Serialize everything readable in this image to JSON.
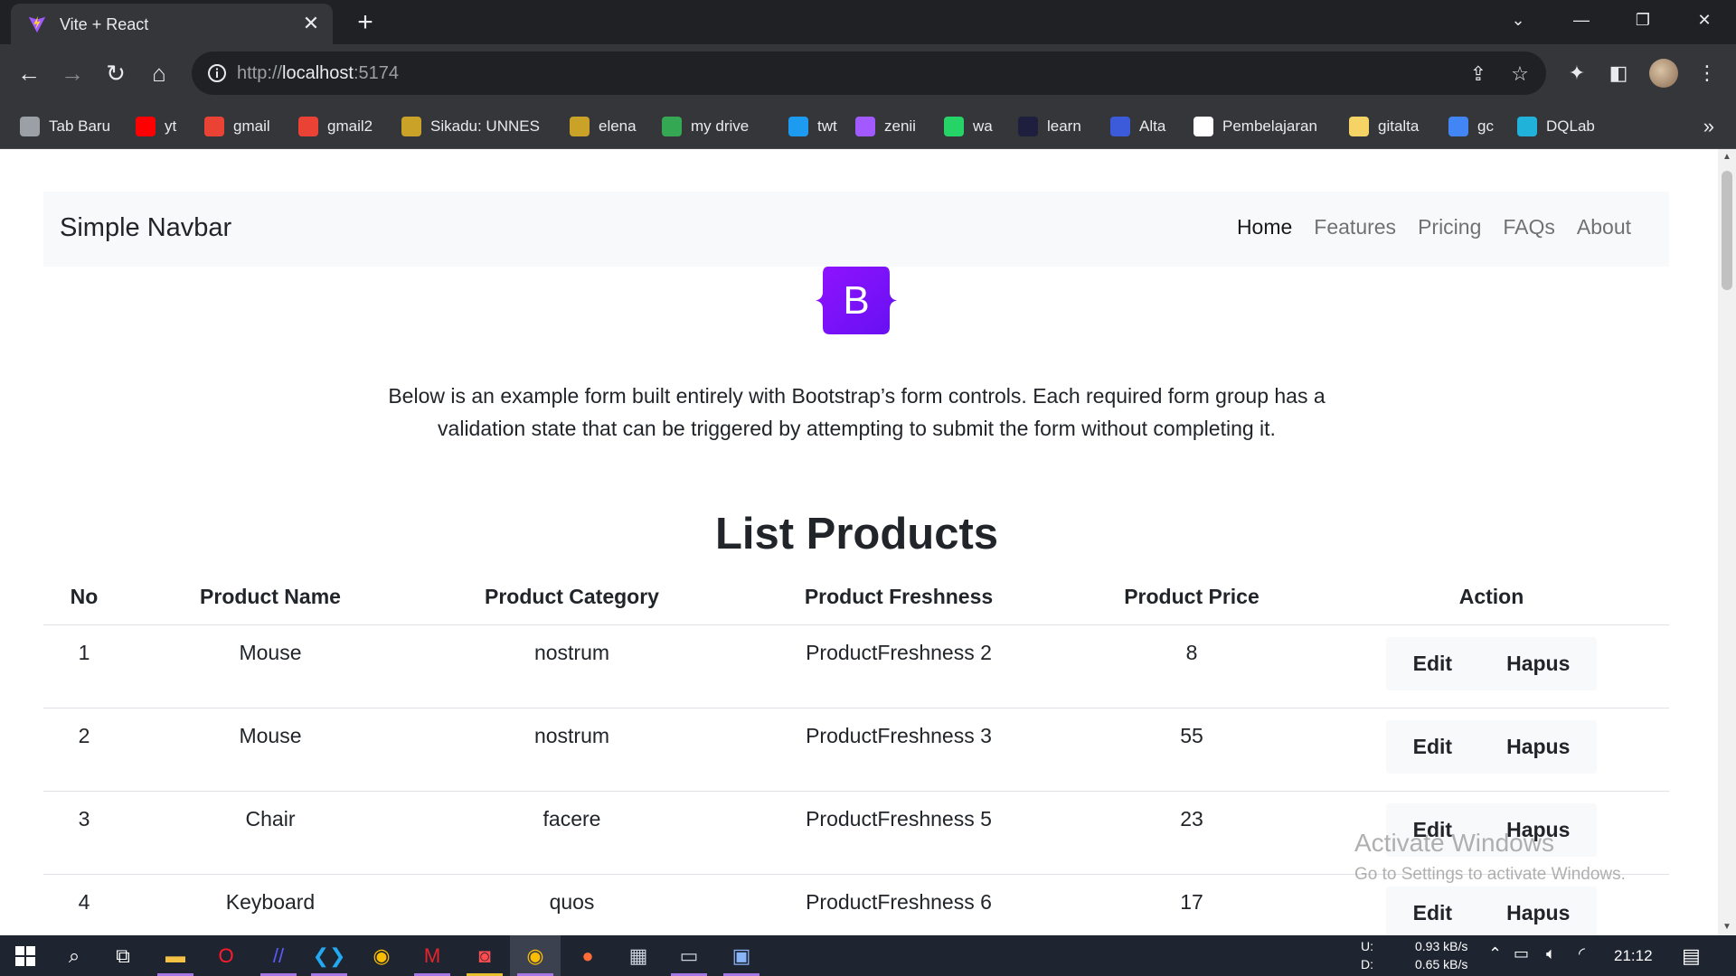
{
  "browser": {
    "tab_title": "Vite + React",
    "tab_close": "✕",
    "new_tab": "+",
    "url_host": "localhost",
    "url_prefix": "http://",
    "url_port": ":5174",
    "window_controls": {
      "chevron": "⌄",
      "minimize": "—",
      "restore": "❐",
      "close": "✕"
    }
  },
  "bookmarks": [
    {
      "label": "Tab Baru",
      "icon": "globe-icon",
      "color": "#9aa0a6"
    },
    {
      "label": "yt",
      "icon": "youtube-icon",
      "color": "#ff0000"
    },
    {
      "label": "gmail",
      "icon": "gmail-icon",
      "color": "#ea4335"
    },
    {
      "label": "gmail2",
      "icon": "gmail-icon",
      "color": "#ea4335"
    },
    {
      "label": "Sikadu: UNNES",
      "icon": "unnes-icon",
      "color": "#c9a227"
    },
    {
      "label": "elena",
      "icon": "unnes-icon",
      "color": "#c9a227"
    },
    {
      "label": "my drive",
      "icon": "drive-icon",
      "color": "#34a853"
    },
    {
      "label": "twt",
      "icon": "twitter-icon",
      "color": "#1d9bf0"
    },
    {
      "label": "zenii",
      "icon": "z-icon",
      "color": "#a259ff"
    },
    {
      "label": "wa",
      "icon": "whatsapp-icon",
      "color": "#25d366"
    },
    {
      "label": "learn",
      "icon": "code-icon",
      "color": "#1e1e3f"
    },
    {
      "label": "Alta",
      "icon": "alta-icon",
      "color": "#3b5bdb"
    },
    {
      "label": "Pembelajaran",
      "icon": "notion-icon",
      "color": "#ffffff"
    },
    {
      "label": "gitalta",
      "icon": "folder-icon",
      "color": "#f6d365"
    },
    {
      "label": "gc",
      "icon": "calendar-icon",
      "color": "#4285f4"
    },
    {
      "label": "DQLab",
      "icon": "dqlab-icon",
      "color": "#20b2d8"
    }
  ],
  "page": {
    "brand": "Simple Navbar",
    "nav": [
      "Home",
      "Features",
      "Pricing",
      "FAQs",
      "About"
    ],
    "logo_letter": "B",
    "logo_color": "#7952b3",
    "lead": "Below is an example form built entirely with Bootstrap’s form controls. Each required form group has a validation state that can be triggered by attempting to submit the form without completing it.",
    "heading": "List Products",
    "table": {
      "headers": [
        "No",
        "Product Name",
        "Product Category",
        "Product Freshness",
        "Product Price",
        "Action"
      ],
      "rows": [
        {
          "no": "1",
          "name": "Mouse",
          "category": "nostrum",
          "freshness": "ProductFreshness 2",
          "price": "8"
        },
        {
          "no": "2",
          "name": "Mouse",
          "category": "nostrum",
          "freshness": "ProductFreshness 3",
          "price": "55"
        },
        {
          "no": "3",
          "name": "Chair",
          "category": "facere",
          "freshness": "ProductFreshness 5",
          "price": "23"
        },
        {
          "no": "4",
          "name": "Keyboard",
          "category": "quos",
          "freshness": "ProductFreshness 6",
          "price": "17"
        }
      ],
      "edit_label": "Edit",
      "delete_label": "Hapus"
    }
  },
  "watermark": {
    "line1": "Activate Windows",
    "line2": "Go to Settings to activate Windows."
  },
  "taskbar": {
    "net_up_label": "U:",
    "net_down_label": "D:",
    "net_up": "0.93 kB/s",
    "net_down": "0.65 kB/s",
    "clock": "21:12"
  }
}
